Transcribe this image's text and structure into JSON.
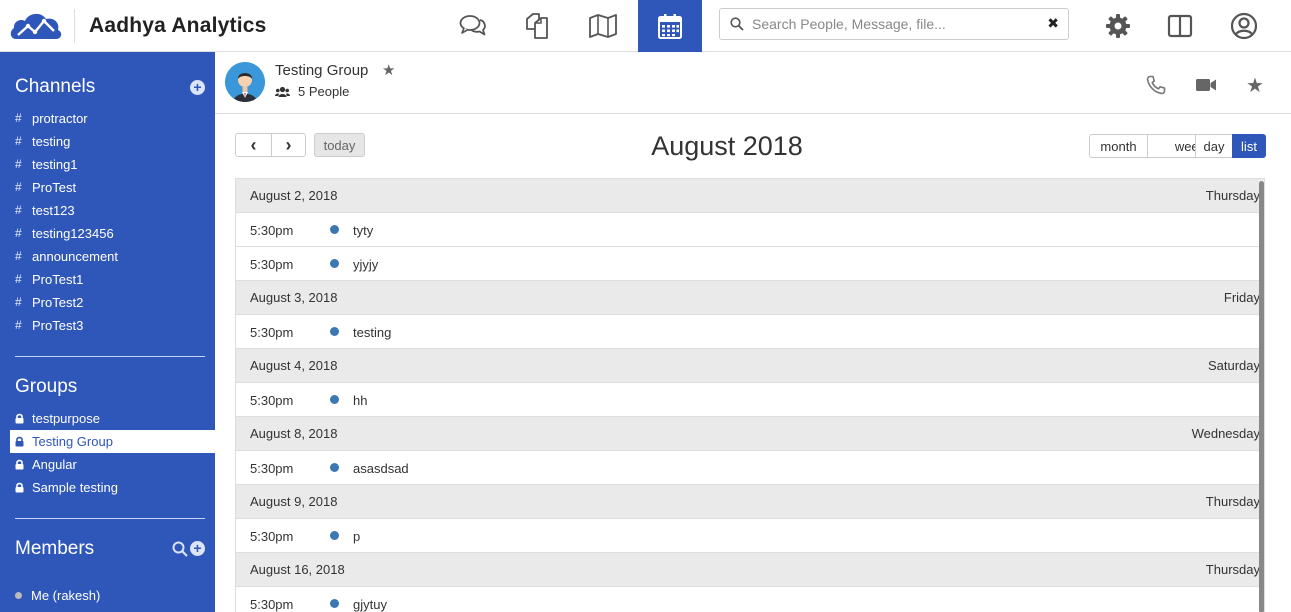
{
  "brand": {
    "name": "Aadhya Analytics",
    "logo_icon": "cloud-graph-logo-icon",
    "accent": "#2f56b9"
  },
  "topnav": [
    {
      "icon": "chat-bubbles-icon",
      "active": false
    },
    {
      "icon": "documents-icon",
      "active": false
    },
    {
      "icon": "map-icon",
      "active": false
    },
    {
      "icon": "calendar-icon",
      "active": true
    }
  ],
  "search": {
    "placeholder": "Search People, Message, file...",
    "value": ""
  },
  "sidebar": {
    "channels_title": "Channels",
    "channels": [
      "protractor",
      "testing",
      "testing1",
      "ProTest",
      "test123",
      "testing123456",
      "announcement",
      "ProTest1",
      "ProTest2",
      "ProTest3"
    ],
    "groups_title": "Groups",
    "groups": [
      {
        "label": "testpurpose",
        "selected": false
      },
      {
        "label": "Testing Group",
        "selected": true
      },
      {
        "label": "Angular",
        "selected": false
      },
      {
        "label": "Sample testing",
        "selected": false
      }
    ],
    "members_title": "Members",
    "members": [
      "Me (rakesh)"
    ]
  },
  "group": {
    "name": "Testing Group",
    "people": "5 People"
  },
  "calendar": {
    "prev": "‹",
    "next": "›",
    "today": "today",
    "title": "August 2018",
    "views": [
      {
        "label": "month",
        "active": false
      },
      {
        "label": "week",
        "active": false
      },
      {
        "label": "day",
        "active": false
      },
      {
        "label": "list",
        "active": true
      }
    ],
    "days": [
      {
        "date": "August 2, 2018",
        "weekday": "Thursday",
        "events": [
          {
            "time": "5:30pm",
            "title": "tyty"
          },
          {
            "time": "5:30pm",
            "title": "yjyjy"
          }
        ]
      },
      {
        "date": "August 3, 2018",
        "weekday": "Friday",
        "events": [
          {
            "time": "5:30pm",
            "title": "testing"
          }
        ]
      },
      {
        "date": "August 4, 2018",
        "weekday": "Saturday",
        "events": [
          {
            "time": "5:30pm",
            "title": "hh"
          }
        ]
      },
      {
        "date": "August 8, 2018",
        "weekday": "Wednesday",
        "events": [
          {
            "time": "5:30pm",
            "title": "asasdsad"
          }
        ]
      },
      {
        "date": "August 9, 2018",
        "weekday": "Thursday",
        "events": [
          {
            "time": "5:30pm",
            "title": "p"
          }
        ]
      },
      {
        "date": "August 16, 2018",
        "weekday": "Thursday",
        "events": [
          {
            "time": "5:30pm",
            "title": "gjytuy"
          }
        ]
      }
    ]
  }
}
